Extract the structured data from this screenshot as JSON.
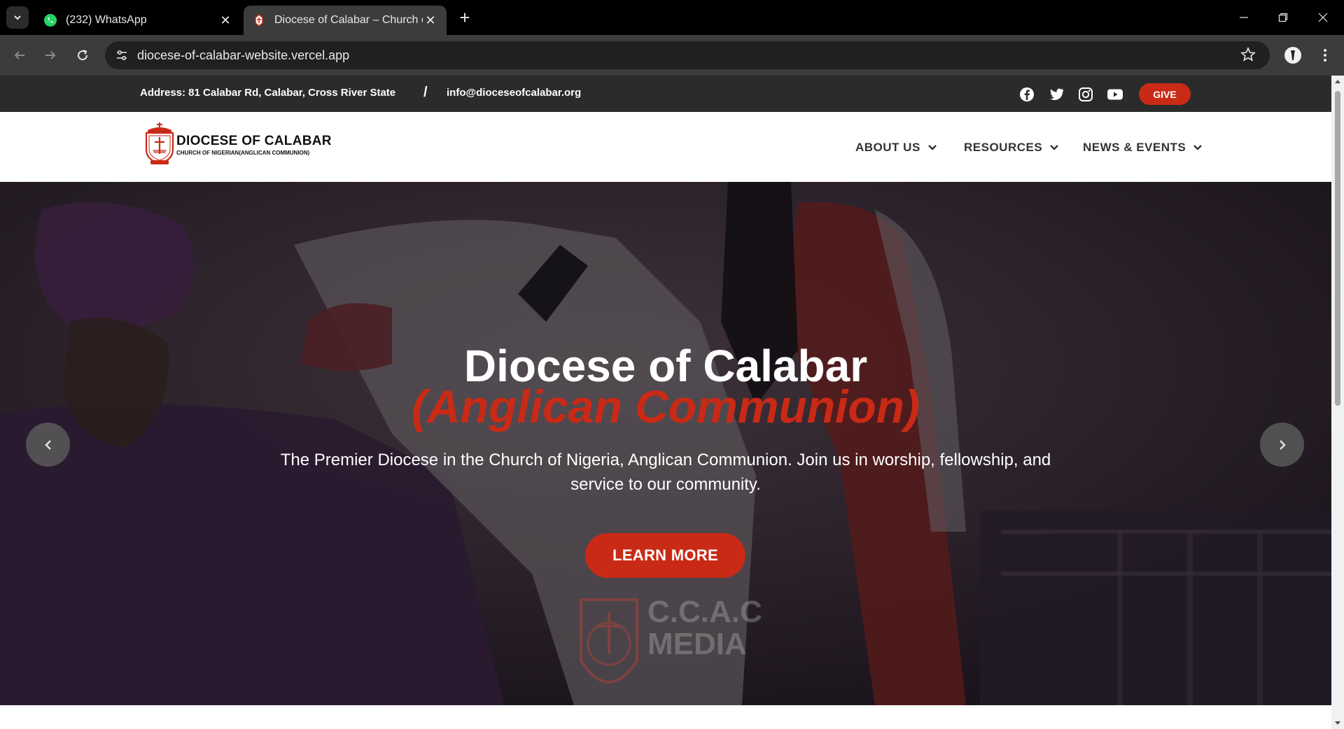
{
  "browser": {
    "tabs": [
      {
        "title": "(232) WhatsApp",
        "favicon": "whatsapp-icon",
        "active": false
      },
      {
        "title": "Diocese of Calabar – Church of",
        "favicon": "diocese-favicon",
        "active": true
      }
    ],
    "url": "diocese-of-calabar-website.vercel.app"
  },
  "topbar": {
    "address": "Address: 81 Calabar Rd, Calabar, Cross River State",
    "separator": "/",
    "email": "info@dioceseofcalabar.org",
    "social": [
      "facebook-icon",
      "twitter-icon",
      "instagram-icon",
      "youtube-icon"
    ],
    "give_label": "GIVE"
  },
  "header": {
    "brand_name": "DIOCESE OF CALABAR",
    "brand_sub": "CHURCH OF NIGERIAN(ANGLICAN COMMUNION)",
    "menu": [
      {
        "label": "ABOUT US"
      },
      {
        "label": "RESOURCES"
      },
      {
        "label": "NEWS & EVENTS"
      }
    ]
  },
  "hero": {
    "title": "Diocese of Calabar",
    "subtitle": "(Anglican Communion)",
    "description": "The Premier Diocese in the Church of Nigeria, Anglican Communion. Join us in worship, fellowship, and service to our community.",
    "cta_label": "LEARN MORE",
    "watermark_line1": "C.C.A.C",
    "watermark_line2": "MEDIA"
  },
  "colors": {
    "accent": "#c92a16",
    "topbar_bg": "#2b2b2b",
    "chrome_bg": "#000000",
    "toolbar_bg": "#3c3c3c"
  }
}
